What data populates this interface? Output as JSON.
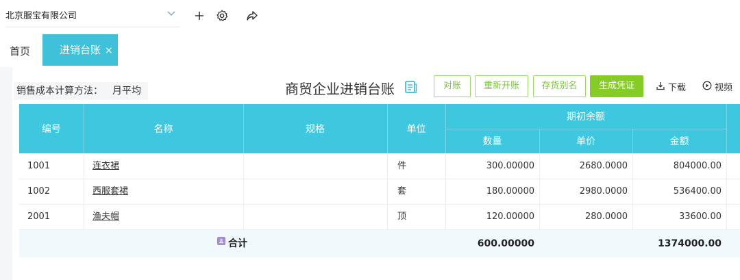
{
  "topbar": {
    "company": "北京服宝有限公司",
    "icons": [
      "chevron-down-icon",
      "plus-icon",
      "gear-icon",
      "share-icon"
    ]
  },
  "tabs": {
    "home": "首页",
    "active": "进销台账",
    "close": "×"
  },
  "toolbar": {
    "method_label": "销售成本计算方法：",
    "method_value": "月平均",
    "title": "商贸企业进销台账",
    "buttons": [
      "对账",
      "重新开账",
      "存货别名",
      "生成凭证"
    ],
    "download": "下载",
    "video": "视频"
  },
  "table": {
    "headers": {
      "code": "编号",
      "name": "名称",
      "spec": "规格",
      "unit": "单位",
      "group": "期初余额",
      "qty": "数量",
      "price": "单价",
      "amount": "金额"
    },
    "rows": [
      {
        "code": "1001",
        "name": "连衣裙",
        "spec": "",
        "unit": "件",
        "qty": "300.00000",
        "price": "2680.0000",
        "amount": "804000.00"
      },
      {
        "code": "1002",
        "name": "西服套裙",
        "spec": "",
        "unit": "套",
        "qty": "180.00000",
        "price": "2980.0000",
        "amount": "536400.00"
      },
      {
        "code": "2001",
        "name": "渔夫帽",
        "spec": "",
        "unit": "顶",
        "qty": "120.00000",
        "price": "280.0000",
        "amount": "33600.00"
      }
    ],
    "total": {
      "label": "合计",
      "qty": "600.00000",
      "amount": "1374000.00"
    }
  }
}
